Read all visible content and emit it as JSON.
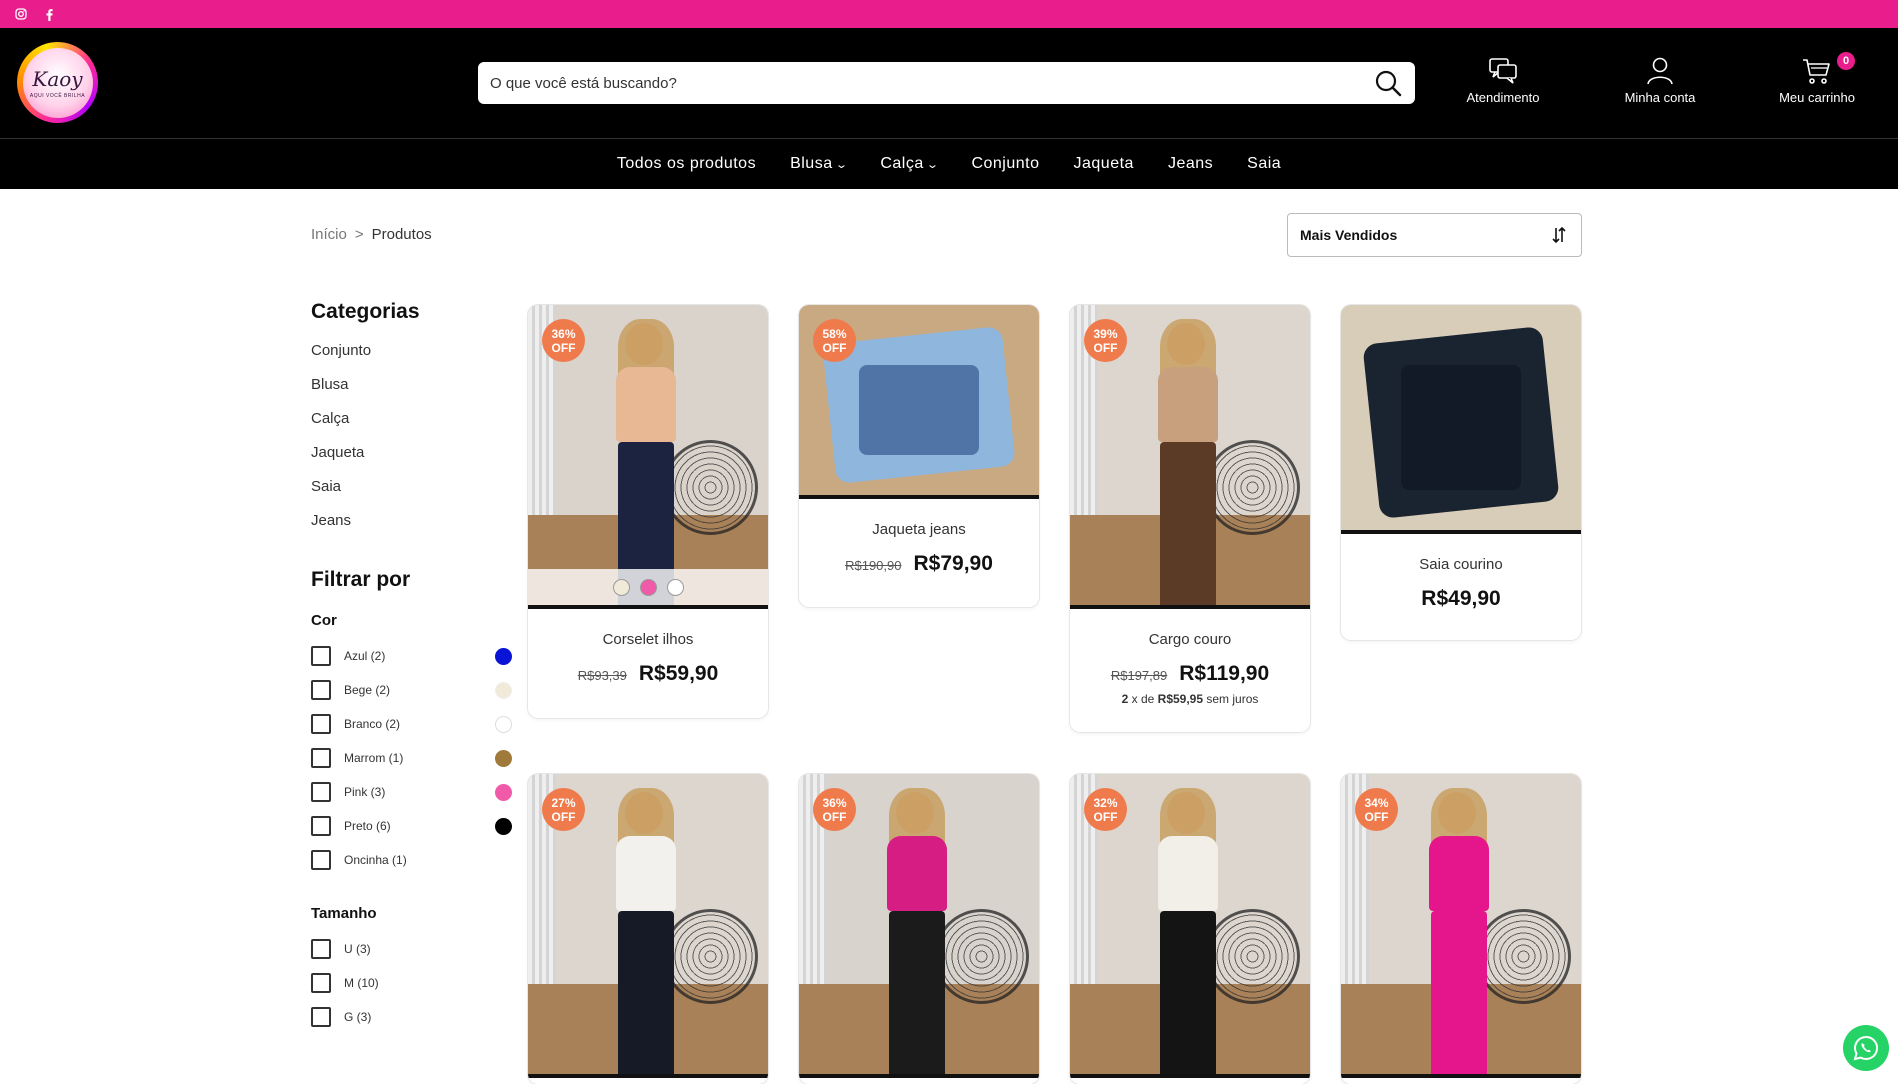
{
  "social": {
    "instagram_icon": "instagram-icon",
    "facebook_icon": "facebook-icon"
  },
  "logo": {
    "brand": "Kaoy",
    "tagline": "AQUI VOCÊ BRILHA"
  },
  "search": {
    "placeholder": "O que você está buscando?",
    "value": ""
  },
  "header_links": {
    "support": "Atendimento",
    "account": "Minha conta",
    "cart": "Meu carrinho",
    "cart_count": "0"
  },
  "nav": [
    {
      "label": "Todos os produtos",
      "dropdown": false
    },
    {
      "label": "Blusa",
      "dropdown": true
    },
    {
      "label": "Calça",
      "dropdown": true
    },
    {
      "label": "Conjunto",
      "dropdown": false
    },
    {
      "label": "Jaqueta",
      "dropdown": false
    },
    {
      "label": "Jeans",
      "dropdown": false
    },
    {
      "label": "Saia",
      "dropdown": false
    }
  ],
  "breadcrumb": {
    "home": "Início",
    "separator": ">",
    "current": "Produtos"
  },
  "sort": {
    "selected": "Mais Vendidos"
  },
  "sidebar": {
    "categories_title": "Categorias",
    "categories": [
      "Conjunto",
      "Blusa",
      "Calça",
      "Jaqueta",
      "Saia",
      "Jeans"
    ],
    "filter_title": "Filtrar por",
    "color_title": "Cor",
    "colors": [
      {
        "label": "Azul (2)",
        "hex": "#0a14d6"
      },
      {
        "label": "Bege (2)",
        "hex": "#f1ead8"
      },
      {
        "label": "Branco (2)",
        "hex": "#ffffff"
      },
      {
        "label": "Marrom (1)",
        "hex": "#a07a3a"
      },
      {
        "label": "Pink (3)",
        "hex": "#f05aa9"
      },
      {
        "label": "Preto (6)",
        "hex": "#000000"
      },
      {
        "label": "Oncinha (1)",
        "hex": ""
      }
    ],
    "size_title": "Tamanho",
    "sizes": [
      "U (3)",
      "M (10)",
      "G (3)"
    ]
  },
  "products": [
    {
      "badge": "36%\nOFF",
      "name": "Corselet ilhos",
      "old": "R$93,39",
      "price": "R$59,90",
      "installment": "",
      "swatches": [
        "#f1ead8",
        "#f05aa9",
        "#ffffff"
      ],
      "top_color": "#e8b895",
      "bottom_color": "#1b2340",
      "bg": "#d9d3cb"
    },
    {
      "badge": "58%\nOFF",
      "name": "Jaqueta jeans",
      "old": "R$190,90",
      "price": "R$79,90",
      "installment": "",
      "swatches": [],
      "top_color": "#8fb6dd",
      "bottom_color": "#1f3e7a",
      "bg": "#c9a982"
    },
    {
      "badge": "39%\nOFF",
      "name": "Cargo couro",
      "old": "R$197,89",
      "price": "R$119,90",
      "installment": "2 x de R$59,95 sem juros",
      "swatches": [],
      "top_color": "#c9a07d",
      "bottom_color": "#5b3a26",
      "bg": "#dcd6ce"
    },
    {
      "badge": "",
      "name": "Saia courino",
      "old": "",
      "price": "R$49,90",
      "installment": "",
      "swatches": [],
      "top_color": "#1a2330",
      "bottom_color": "#0d1420",
      "bg": "#d8cdb8"
    },
    {
      "badge": "27%\nOFF",
      "name": "",
      "old": "",
      "price": "",
      "installment": "",
      "swatches": [],
      "top_color": "#f3f1ee",
      "bottom_color": "#151a26",
      "bg": "#dcd6ce"
    },
    {
      "badge": "36%\nOFF",
      "name": "",
      "old": "",
      "price": "",
      "installment": "",
      "swatches": [],
      "top_color": "#d61d83",
      "bottom_color": "#1b1b1b",
      "bg": "#d8d3cc"
    },
    {
      "badge": "32%\nOFF",
      "name": "",
      "old": "",
      "price": "",
      "installment": "",
      "swatches": [],
      "top_color": "#f2efe9",
      "bottom_color": "#141414",
      "bg": "#dcd6ce"
    },
    {
      "badge": "34%\nOFF",
      "name": "",
      "old": "",
      "price": "",
      "installment": "",
      "swatches": [],
      "top_color": "#e5168c",
      "bottom_color": "#e5168c",
      "bg": "#dcd6ce"
    }
  ],
  "whatsapp_icon": "whatsapp-icon"
}
